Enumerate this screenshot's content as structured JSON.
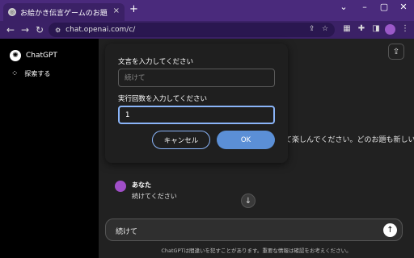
{
  "browser": {
    "tab_title": "お絵かき伝言ゲームのお題",
    "tab_close": "×",
    "new_tab": "+",
    "window_controls": [
      "⌄",
      "–",
      "▢",
      "✕"
    ],
    "nav": {
      "back": "←",
      "forward": "→",
      "reload": "↻"
    },
    "url": "chat.openai.com/c/"
  },
  "sidebar": {
    "brand": "ChatGPT",
    "explore_label": "探索する"
  },
  "main": {
    "background_text_line1": "て楽しんでください。どのお題も新しい",
    "background_text_line2": "",
    "message": {
      "author": "あなた",
      "text": "続けてください"
    },
    "composer_text": "続けて",
    "disclaimer": "ChatGPTは間違いを犯すことがあります。重要な情報は確認をお考えください。"
  },
  "dialog": {
    "label1": "文言を入力してください",
    "input1_placeholder": "続けて",
    "label2": "実行回数を入力してください",
    "input2_value": "1",
    "cancel_label": "キャンセル",
    "ok_label": "OK"
  },
  "colors": {
    "accent": "#8ab4f8",
    "ok_button": "#5b8fd6",
    "frame": "#4a2a7c"
  }
}
